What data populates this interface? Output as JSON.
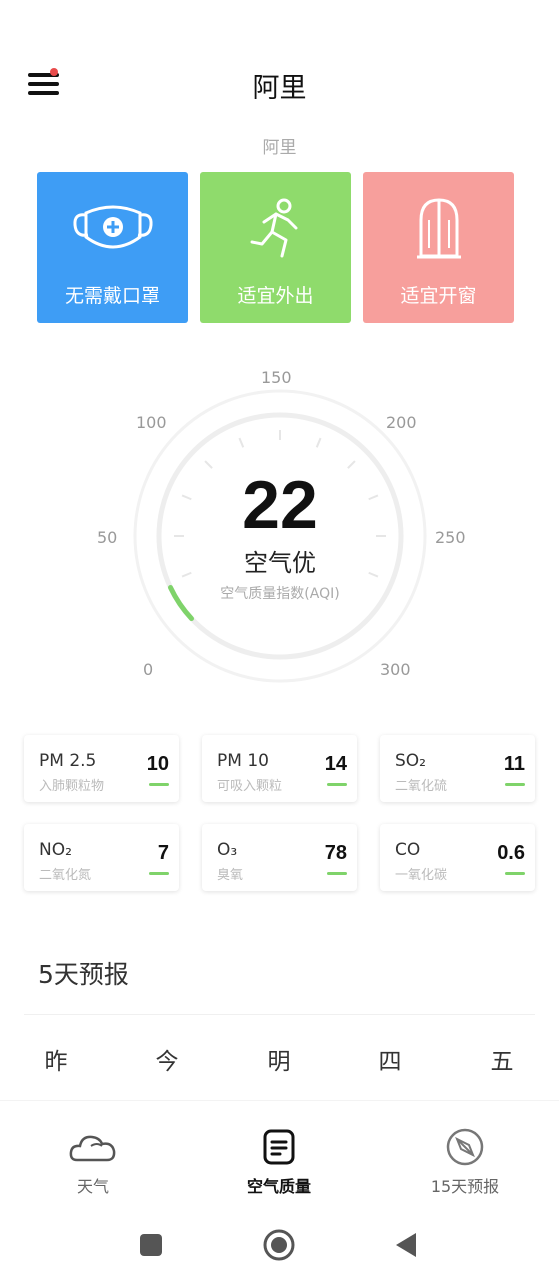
{
  "header": {
    "title": "阿里",
    "subtitle": "阿里"
  },
  "tips": [
    {
      "label": "无需戴口罩",
      "icon": "mask-icon",
      "color": "#3e9df5"
    },
    {
      "label": "适宜外出",
      "icon": "running-person-icon",
      "color": "#8fdb6c"
    },
    {
      "label": "适宜开窗",
      "icon": "window-icon",
      "color": "#f79f9c"
    }
  ],
  "aqi": {
    "value": "22",
    "status": "空气优",
    "caption": "空气质量指数(AQI)",
    "scale": [
      "0",
      "50",
      "100",
      "150",
      "200",
      "250",
      "300"
    ],
    "max": 300,
    "level_color": "#7fd36a"
  },
  "pollutants": [
    {
      "name": "PM 2.5",
      "desc": "入肺颗粒物",
      "value": "10"
    },
    {
      "name": "PM 10",
      "desc": "可吸入颗粒",
      "value": "14"
    },
    {
      "name": "SO₂",
      "desc": "二氧化硫",
      "value": "11"
    },
    {
      "name": "NO₂",
      "desc": "二氧化氮",
      "value": "7"
    },
    {
      "name": "O₃",
      "desc": "臭氧",
      "value": "78"
    },
    {
      "name": "CO",
      "desc": "一氧化碳",
      "value": "0.6"
    }
  ],
  "forecast": {
    "title": "5天预报",
    "days": [
      "昨",
      "今",
      "明",
      "四",
      "五"
    ]
  },
  "nav": [
    {
      "label": "天气",
      "icon": "cloud-icon"
    },
    {
      "label": "空气质量",
      "icon": "document-icon",
      "active": true
    },
    {
      "label": "15天预报",
      "icon": "compass-icon"
    }
  ],
  "system_nav": [
    "recent-apps-icon",
    "home-icon",
    "back-icon"
  ]
}
